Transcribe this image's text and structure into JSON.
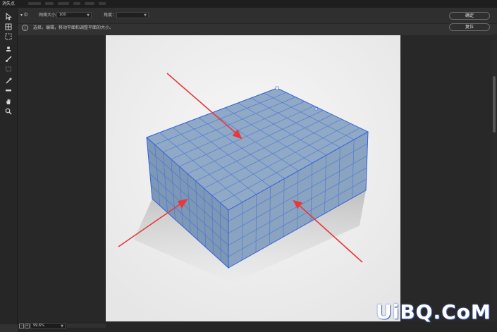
{
  "window": {
    "title": "消失点"
  },
  "options": {
    "grid_size_label": "网格大小：",
    "grid_size_value": "100",
    "angle_label": "角度：",
    "angle_value": "",
    "mode_label": "▾ 中"
  },
  "hint": {
    "text": "选择，编辑，移动平面和调整平面的大小。"
  },
  "buttons": {
    "ok": "确定",
    "reset": "复位"
  },
  "status": {
    "zoom": "99.6%",
    "minus": "-",
    "plus": "+"
  },
  "watermark": "UiBQ.CoM",
  "icons": [
    "edit-plane-tool",
    "create-plane-tool",
    "marquee-tool",
    "stamp-tool",
    "brush-tool",
    "transform-tool",
    "eyedropper-tool",
    "measure-tool",
    "hand-tool",
    "zoom-tool"
  ]
}
